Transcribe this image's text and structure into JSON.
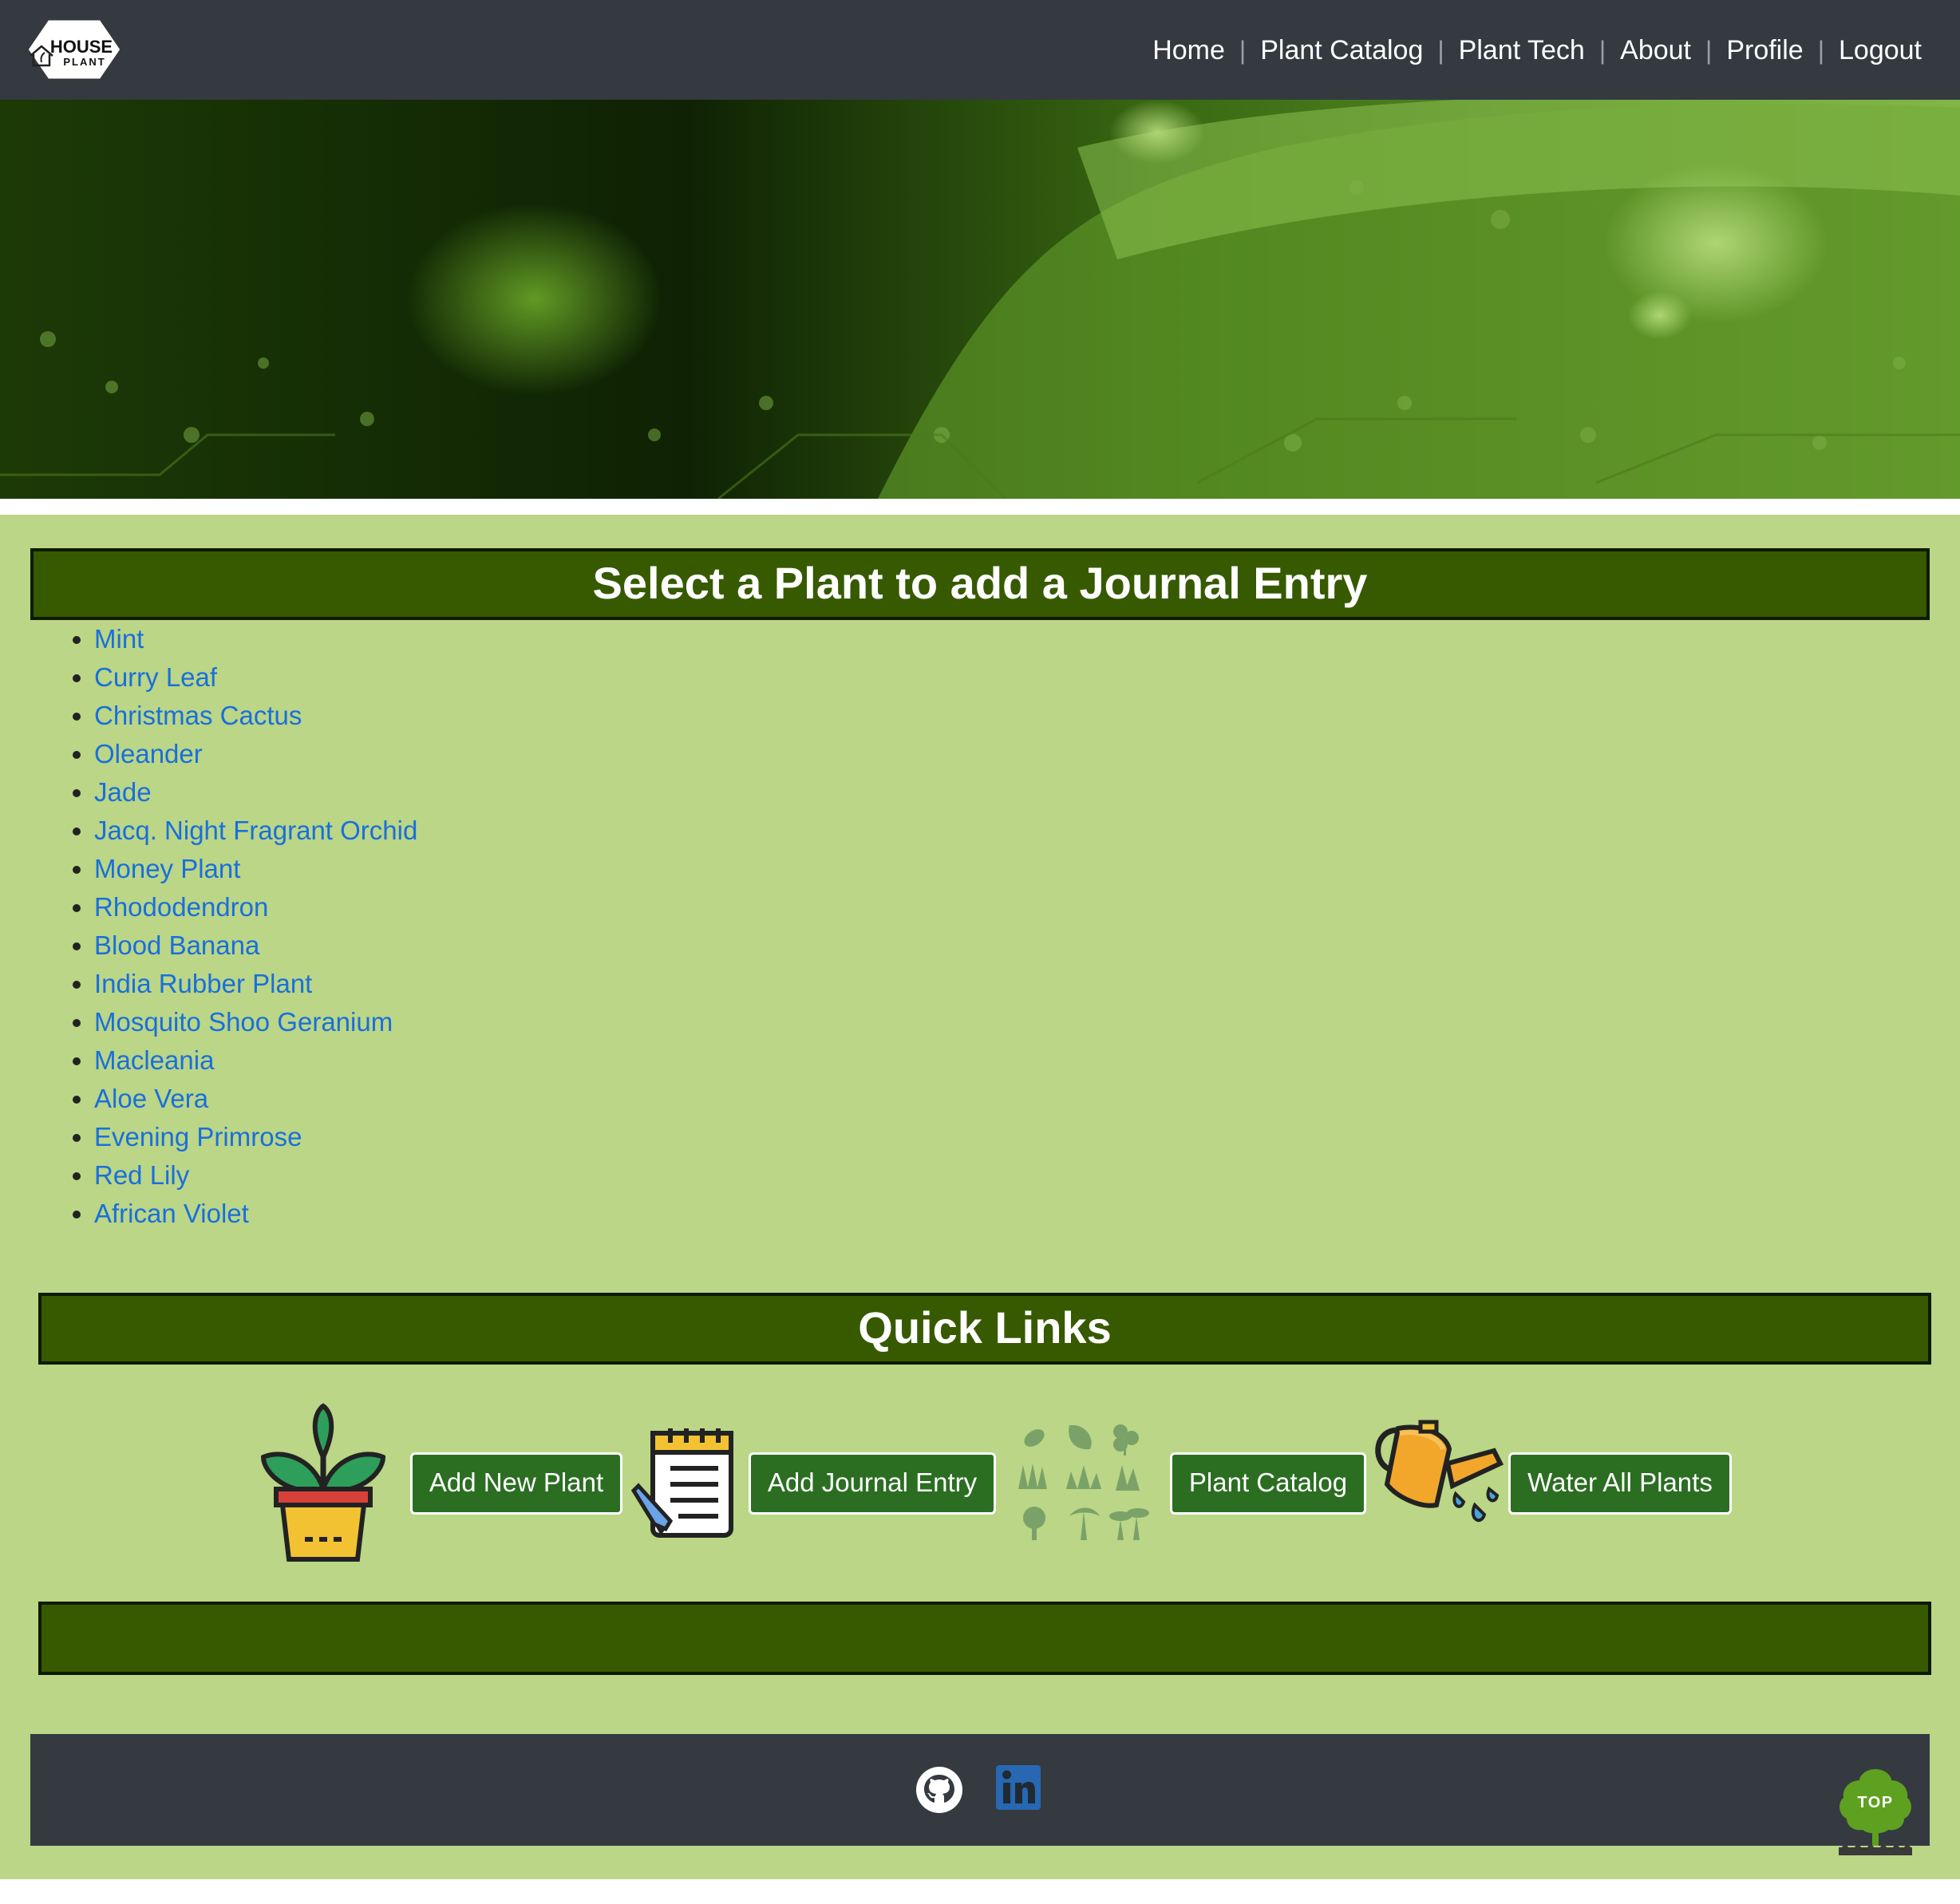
{
  "logo": {
    "line1": "HOUSE",
    "line2": "PLANT",
    "icon": "house-plant-logo-icon"
  },
  "nav": {
    "items": [
      "Home",
      "Plant Catalog",
      "Plant Tech",
      "About",
      "Profile",
      "Logout"
    ],
    "separator": "|"
  },
  "hero": {
    "image": "green-leaf-circuit-board-banner"
  },
  "journal": {
    "heading": "Select a Plant to add a Journal Entry",
    "plants": [
      "Mint",
      "Curry Leaf",
      "Christmas Cactus",
      "Oleander",
      "Jade",
      "Jacq. Night Fragrant Orchid",
      "Money Plant",
      "Rhododendron",
      "Blood Banana",
      "India Rubber Plant",
      "Mosquito Shoo Geranium",
      "Macleania",
      "Aloe Vera",
      "Evening Primrose",
      "Red Lily",
      "African Violet"
    ]
  },
  "quick_links": {
    "heading": "Quick Links",
    "items": [
      {
        "icon": "potted-plant-icon",
        "label": "Add New Plant"
      },
      {
        "icon": "notepad-pencil-icon",
        "label": "Add Journal Entry"
      },
      {
        "icon": "plant-types-grid-icon",
        "label": "Plant Catalog"
      },
      {
        "icon": "watering-can-icon",
        "label": "Water All Plants"
      }
    ]
  },
  "footer": {
    "icons": [
      "github-icon",
      "linkedin-icon"
    ],
    "top_button": "TOP"
  },
  "colors": {
    "navbar": "#343a40",
    "page_bg": "#bad686",
    "section_bar": "#375a00",
    "link": "#1a6fdc",
    "button": "#2b6e22"
  }
}
